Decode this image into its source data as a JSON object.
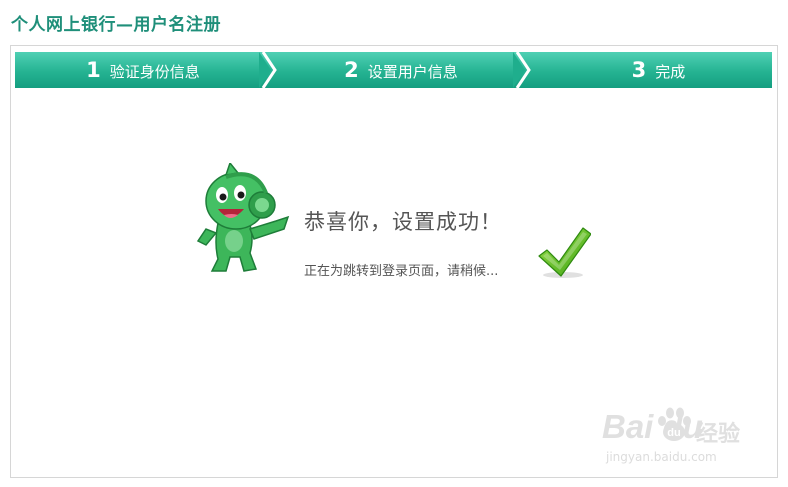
{
  "header": {
    "title": "个人网上银行—用户名注册"
  },
  "steps": [
    {
      "number": "1",
      "label": "验证身份信息",
      "state": "done"
    },
    {
      "number": "2",
      "label": "设置用户信息",
      "state": "done"
    },
    {
      "number": "3",
      "label": "完成",
      "state": "active"
    }
  ],
  "result": {
    "title": "恭喜你，设置成功！",
    "redirect_text": "正在为跳转到登录页面，请稍候..."
  },
  "icons": {
    "mascot": "mascot-icon",
    "success": "checkmark-icon"
  },
  "colors": {
    "accent": "#1f8f7a",
    "step_bar": "#25b392",
    "check": "#5cbf1c",
    "mascot": "#3db65a"
  },
  "watermark": {
    "brand": "Bai du",
    "cn_text": "经验",
    "url": "jingyan.baidu.com"
  }
}
